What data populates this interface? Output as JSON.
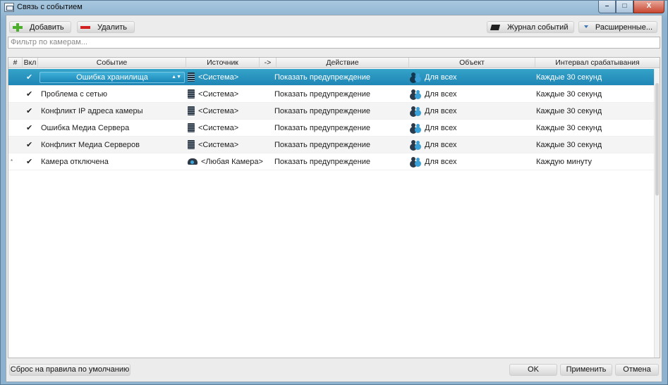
{
  "window": {
    "title": "Связь с событием",
    "minimize": "–",
    "maximize": "□",
    "close": "X"
  },
  "toolbar": {
    "add_label": "Добавить",
    "remove_label": "Удалить",
    "journal_label": "Журнал событий",
    "advanced_label": "Расширенные..."
  },
  "filter": {
    "placeholder": "Фильтр по камерам..."
  },
  "table": {
    "headers": {
      "num": "#",
      "enabled": "Вкл",
      "event": "Событие",
      "source": "Источник",
      "arrow": "->",
      "action": "Действие",
      "target": "Объект",
      "interval": "Интервал срабатывания"
    },
    "rows": [
      {
        "marker": "",
        "enabled": "✔",
        "event": "Ошибка хранилища",
        "source": "<Система>",
        "source_icon": "server-icon",
        "action": "Показать предупреждение",
        "target": "Для всех",
        "interval": "Каждые 30 секунд",
        "selected": true
      },
      {
        "marker": "",
        "enabled": "✔",
        "event": "Проблема с сетью",
        "source": "<Система>",
        "source_icon": "server-icon",
        "action": "Показать предупреждение",
        "target": "Для всех",
        "interval": "Каждые 30 секунд"
      },
      {
        "marker": "",
        "enabled": "✔",
        "event": "Конфликт IP адреса камеры",
        "source": "<Система>",
        "source_icon": "server-icon",
        "action": "Показать предупреждение",
        "target": "Для всех",
        "interval": "Каждые 30 секунд"
      },
      {
        "marker": "",
        "enabled": "✔",
        "event": "Ошибка Медиа Сервера",
        "source": "<Система>",
        "source_icon": "server-icon",
        "action": "Показать предупреждение",
        "target": "Для всех",
        "interval": "Каждые 30 секунд"
      },
      {
        "marker": "",
        "enabled": "✔",
        "event": "Конфликт Медиа Серверов",
        "source": "<Система>",
        "source_icon": "server-icon",
        "action": "Показать предупреждение",
        "target": "Для всех",
        "interval": "Каждые 30 секунд"
      },
      {
        "marker": "*",
        "enabled": "✔",
        "event": "Камера отключена",
        "source": "<Любая Камера>",
        "source_icon": "camera-icon",
        "action": "Показать предупреждение",
        "target": "Для всех",
        "interval": "Каждую минуту"
      }
    ]
  },
  "footer": {
    "reset_label": "Сброс на правила по умолчанию",
    "ok_label": "OK",
    "apply_label": "Применить",
    "cancel_label": "Отмена"
  },
  "colors": {
    "selection": "#2596c2",
    "add_icon": "#4caf2c",
    "remove_icon": "#d21f1f"
  }
}
